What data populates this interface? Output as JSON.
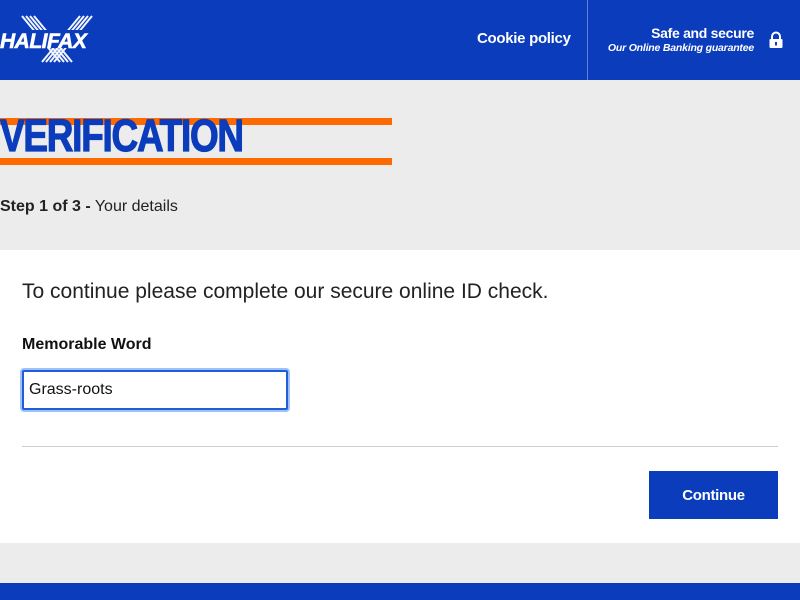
{
  "header": {
    "logo_text": "HALIFAX",
    "cookie_label": "Cookie policy",
    "safe_title": "Safe and secure",
    "safe_subtitle": "Our Online Banking guarantee",
    "lock_icon": "lock-icon"
  },
  "title_band": {
    "title": "VERIFICATION",
    "step_bold": "Step 1 of 3 -",
    "step_text": "Your details"
  },
  "form": {
    "intro": "To continue please complete our secure online ID check.",
    "memorable_label": "Memorable Word",
    "memorable_value": "Grass-roots",
    "continue_label": "Continue"
  },
  "colors": {
    "brand_blue": "#0a3cbc",
    "accent_orange": "#ff6a00"
  }
}
